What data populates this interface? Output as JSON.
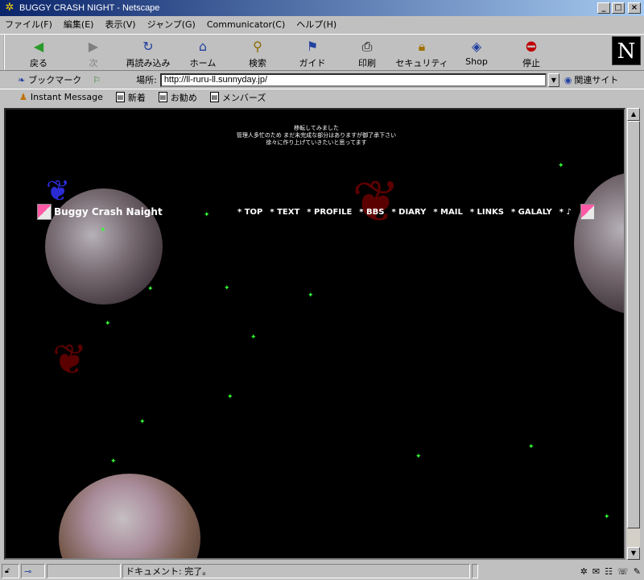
{
  "window": {
    "title": "BUGGY CRASH NIGHT - Netscape"
  },
  "menubar": [
    "ファイル(F)",
    "編集(E)",
    "表示(V)",
    "ジャンプ(G)",
    "Communicator(C)",
    "ヘルプ(H)"
  ],
  "toolbar": {
    "back": "戻る",
    "forward": "次",
    "reload": "再読み込み",
    "home": "ホーム",
    "search": "検索",
    "guide": "ガイド",
    "print": "印刷",
    "security": "セキュリティ",
    "shop": "Shop",
    "stop": "停止"
  },
  "location": {
    "bookmarks": "ブックマーク",
    "label": "場所:",
    "url": "http://ll-ruru-ll.sunnyday.jp/",
    "related": "関連サイト"
  },
  "personal_bar": [
    "Instant Message",
    "新着",
    "お勧め",
    "メンバーズ"
  ],
  "page": {
    "notice_lines": [
      "移転してみました",
      "管理人多忙のため まだ未完成な部分はありますが御了承下さい",
      "徐々に作り上げていきたいと思ってます"
    ],
    "site_title": "Buggy Crash Naight",
    "nav": [
      "* TOP",
      "* TEXT",
      "* PROFILE",
      "* BBS",
      "* DIARY",
      "* MAIL",
      "* LINKS",
      "* GALALY",
      "* ♪"
    ]
  },
  "status": {
    "text": "ドキュメント: 完了。"
  },
  "colors": {
    "background": "#000000",
    "star": "#33ff33",
    "butterfly_red": "#8b0000",
    "butterfly_blue": "#2b2bd6",
    "accent_pink": "#ff5aa5"
  }
}
